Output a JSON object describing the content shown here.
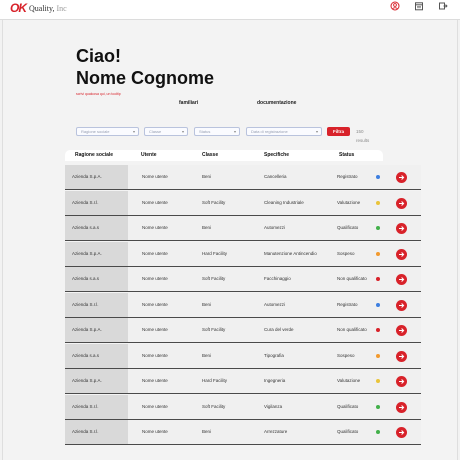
{
  "brand": {
    "mark": "OK",
    "name": "Quality",
    "suffix": "Inc"
  },
  "topbar": {
    "icons": [
      "user-icon",
      "calendar-icon",
      "logout-icon"
    ]
  },
  "header": {
    "greeting": "Ciao!",
    "user_name": "Nome Cognome",
    "subtitle": "scrivi qualcosa qui, un tooltip"
  },
  "nav": {
    "item1": "familiari",
    "item2": "documentazione"
  },
  "filters": {
    "ragione": "Ragione sociale",
    "classe": "Classe",
    "status": "Status",
    "data": "Data di registrazione",
    "button": "Filtra",
    "count": "150 results"
  },
  "table": {
    "headers": {
      "ragione": "Ragione sociale",
      "utente": "Utente",
      "classe": "Classe",
      "specifiche": "Specifiche",
      "status": "Status"
    },
    "rows": [
      {
        "ragione": "Azienda S.p.A.",
        "utente": "Nome utente",
        "classe": "Beni",
        "specifiche": "Cancelleria",
        "status": "Registrato",
        "dot": "#3d7fe0"
      },
      {
        "ragione": "Azienda S.r.l.",
        "utente": "Nome utente",
        "classe": "Soft Facility",
        "specifiche": "Cleaning Industriale",
        "status": "Valutazione",
        "dot": "#e9c43a"
      },
      {
        "ragione": "Azienda s.a.s",
        "utente": "Nome utente",
        "classe": "Beni",
        "specifiche": "Automezzi",
        "status": "Qualificato",
        "dot": "#43b04a"
      },
      {
        "ragione": "Azienda S.p.A.",
        "utente": "Nome utente",
        "classe": "Hard Facility",
        "specifiche": "Manutenzione Antincendio",
        "status": "Sospeso",
        "dot": "#f29a2e"
      },
      {
        "ragione": "Azienda s.a.s",
        "utente": "Nome utente",
        "classe": "Soft Facility",
        "specifiche": "Facchinaggio",
        "status": "Non qualificato",
        "dot": "#d8222a"
      },
      {
        "ragione": "Azienda S.r.l.",
        "utente": "Nome utente",
        "classe": "Beni",
        "specifiche": "Automezzi",
        "status": "Registrato",
        "dot": "#3d7fe0"
      },
      {
        "ragione": "Azienda S.p.A.",
        "utente": "Nome utente",
        "classe": "Soft Facility",
        "specifiche": "Cura del verde",
        "status": "Non qualificato",
        "dot": "#d8222a"
      },
      {
        "ragione": "Azienda s.a.s",
        "utente": "Nome utente",
        "classe": "Beni",
        "specifiche": "Tipografia",
        "status": "Sospeso",
        "dot": "#f29a2e"
      },
      {
        "ragione": "Azienda S.p.A.",
        "utente": "Nome utente",
        "classe": "Hard Facility",
        "specifiche": "Ingegneria",
        "status": "Valutazione",
        "dot": "#e9c43a"
      },
      {
        "ragione": "Azienda S.r.l.",
        "utente": "Nome utente",
        "classe": "Soft Facility",
        "specifiche": "Vigilanza",
        "status": "Qualificato",
        "dot": "#43b04a"
      },
      {
        "ragione": "Azienda S.r.l.",
        "utente": "Nome utente",
        "classe": "Beni",
        "specifiche": "Arrezzature",
        "status": "Qualificato",
        "dot": "#43b04a"
      }
    ]
  },
  "colors": {
    "accent": "#d8222a",
    "row_bg": "#f0f0f0",
    "first_col_bg": "#d9d9d9"
  }
}
